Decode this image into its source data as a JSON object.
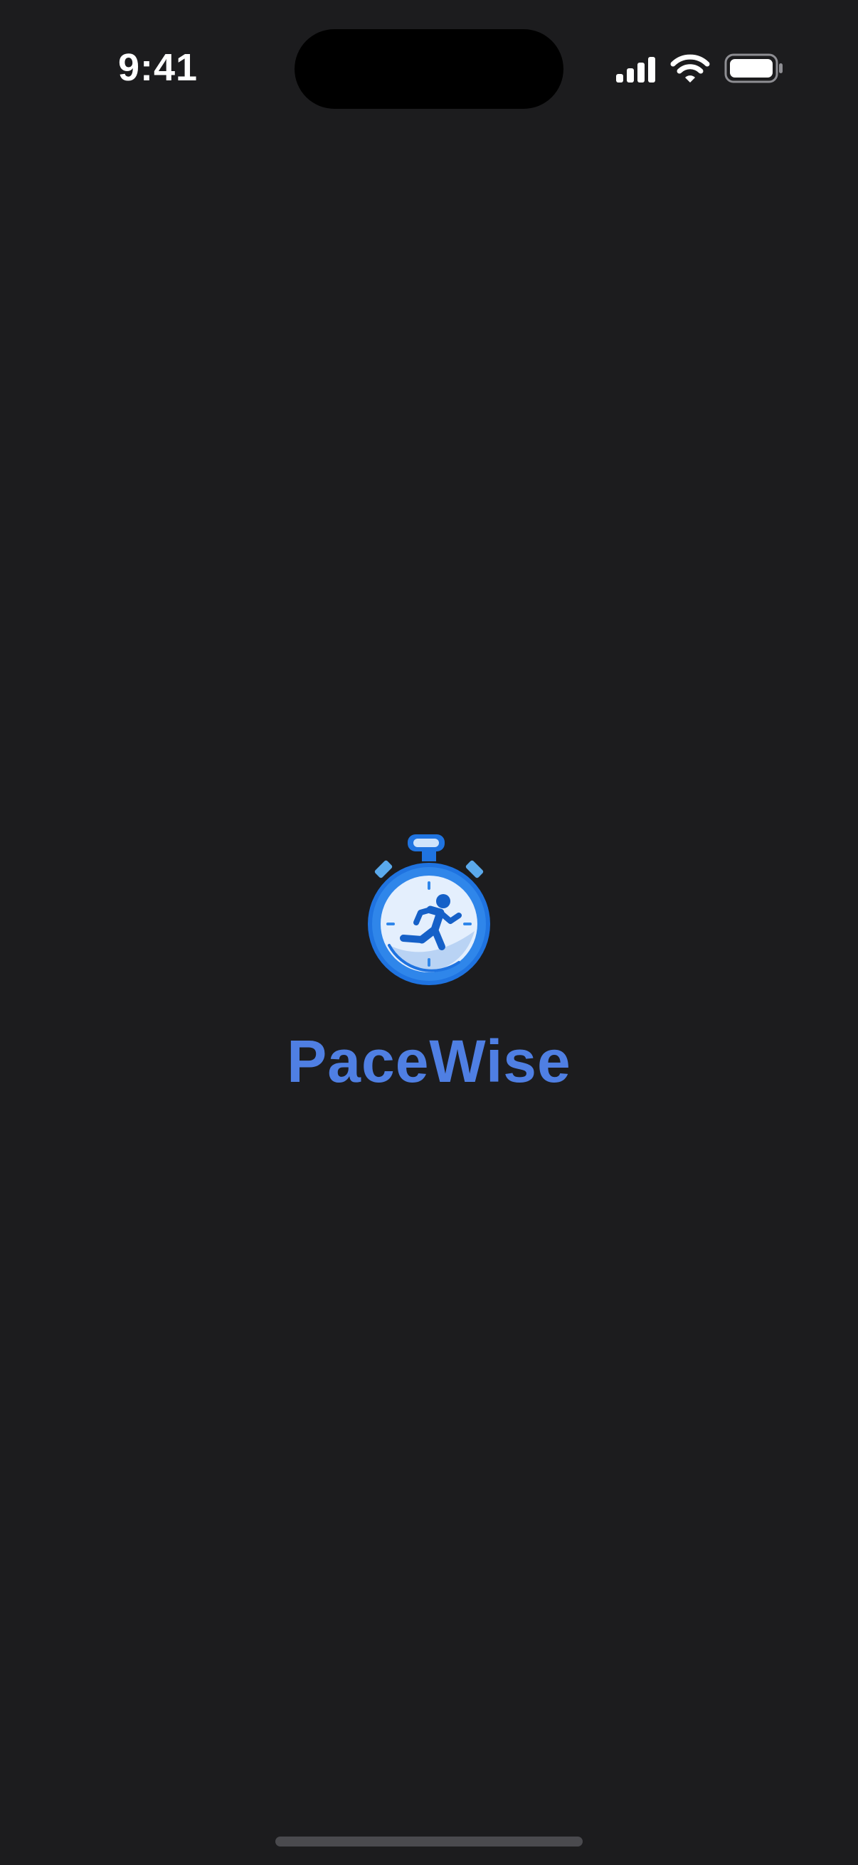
{
  "status_bar": {
    "time": "9:41",
    "icons": [
      "cellular-signal-icon",
      "wifi-icon",
      "battery-icon"
    ]
  },
  "splash": {
    "logo_icon": "stopwatch-runner-icon",
    "app_name": "PaceWise"
  },
  "colors": {
    "background": "#1c1c1e",
    "brand_text": "#4f7fe3",
    "logo_ring": "#1f73e0",
    "logo_face": "#dbeafc",
    "runner": "#1560c8"
  }
}
